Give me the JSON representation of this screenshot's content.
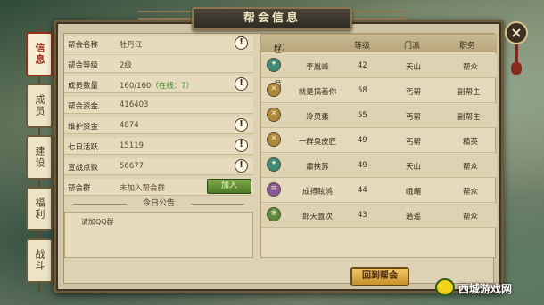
{
  "title": "帮会信息",
  "close_icon": "×",
  "tabs": [
    {
      "label": "信息",
      "active": true
    },
    {
      "label": "成员",
      "active": false
    },
    {
      "label": "建设",
      "active": false
    },
    {
      "label": "福利",
      "active": false
    },
    {
      "label": "战斗",
      "active": false
    }
  ],
  "info": {
    "guild_name_label": "帮会名称",
    "guild_name": "牡丹江",
    "guild_level_label": "帮会等级",
    "guild_level": "2级",
    "member_count_label": "成员数量",
    "member_count": "160/160",
    "online_text": "（在线：7）",
    "funds_label": "帮会资金",
    "funds": "416403",
    "maintenance_label": "维护资金",
    "maintenance": "4874",
    "activity_label": "七日活跃",
    "activity": "15119",
    "war_points_label": "宣战点数",
    "war_points": "56677",
    "group_label": "帮会群",
    "group_value": "未加入帮会群",
    "join_button": "加入",
    "help_icon": "!"
  },
  "notice": {
    "title": "今日公告",
    "content": "请加QQ群"
  },
  "members": {
    "headers": {
      "name": "在线成员",
      "count": "(7)",
      "level": "等级",
      "sect": "门派",
      "role": "职务"
    },
    "rows": [
      {
        "name": "李胤峰",
        "level": "42",
        "sect": "天山",
        "role": "帮众",
        "icon": "tianshan-icon"
      },
      {
        "name": "就是搞着你",
        "level": "58",
        "sect": "丐帮",
        "role": "副帮主",
        "icon": "gaibang-icon"
      },
      {
        "name": "冷灵素",
        "level": "55",
        "sect": "丐帮",
        "role": "副帮主",
        "icon": "gaibang-icon"
      },
      {
        "name": "一群臭皮匠",
        "level": "49",
        "sect": "丐帮",
        "role": "精英",
        "icon": "gaibang-icon"
      },
      {
        "name": "肅扶苏",
        "level": "49",
        "sect": "天山",
        "role": "帮众",
        "icon": "tianshan-icon"
      },
      {
        "name": "成搏眩鸲",
        "level": "44",
        "sect": "峨嵋",
        "role": "帮众",
        "icon": "emei-icon"
      },
      {
        "name": "郎天置次",
        "level": "43",
        "sect": "逍遥",
        "role": "帮众",
        "icon": "xiaoyao-icon"
      }
    ]
  },
  "return_button": "回到帮会",
  "watermark": "西城游戏网"
}
